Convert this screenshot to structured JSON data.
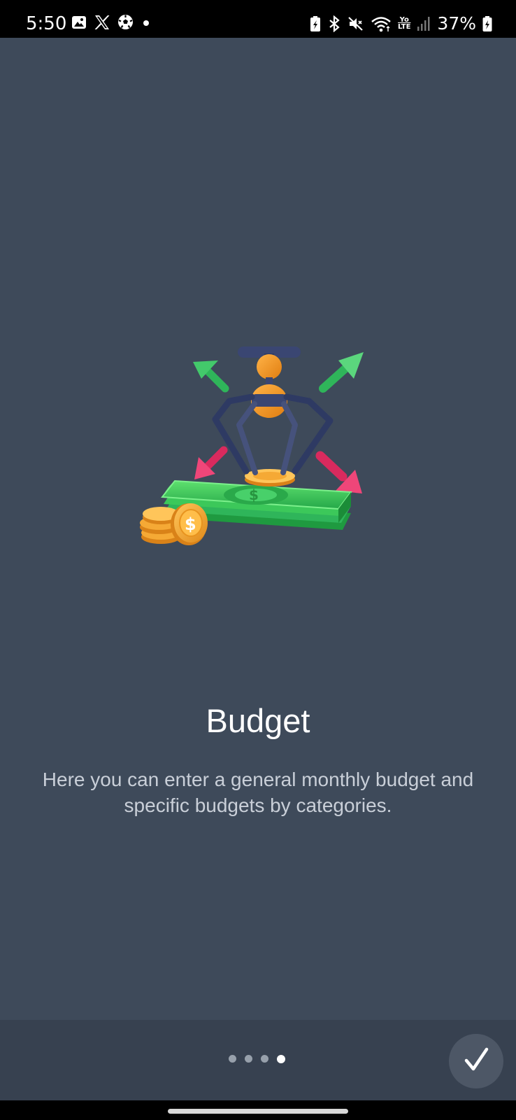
{
  "status_bar": {
    "time": "5:50",
    "left_icons": [
      "gallery-icon",
      "x-icon",
      "soccer-ball-icon",
      "dot-icon"
    ],
    "right_icons": [
      "battery-saver-icon",
      "bluetooth-icon",
      "mute-icon",
      "wifi-icon",
      "volte-icon",
      "signal-icon"
    ],
    "volte_label_top": "Yo",
    "volte_label_bottom": "LTE",
    "battery": "37%"
  },
  "onboarding": {
    "title": "Budget",
    "description": "Here you can enter a general monthly budget and specific budgets by categories.",
    "illustration": "budget-claw-money-illustration"
  },
  "pager": {
    "total_pages": 4,
    "current_page": 4
  },
  "done_button": {
    "icon": "checkmark-icon"
  },
  "colors": {
    "background": "#3e4a5a",
    "bottom_bar": "#374150",
    "arrow_up": "#2fb55a",
    "arrow_down": "#e8336b",
    "money_green": "#3cc85a",
    "coin_gold": "#f0a830"
  }
}
